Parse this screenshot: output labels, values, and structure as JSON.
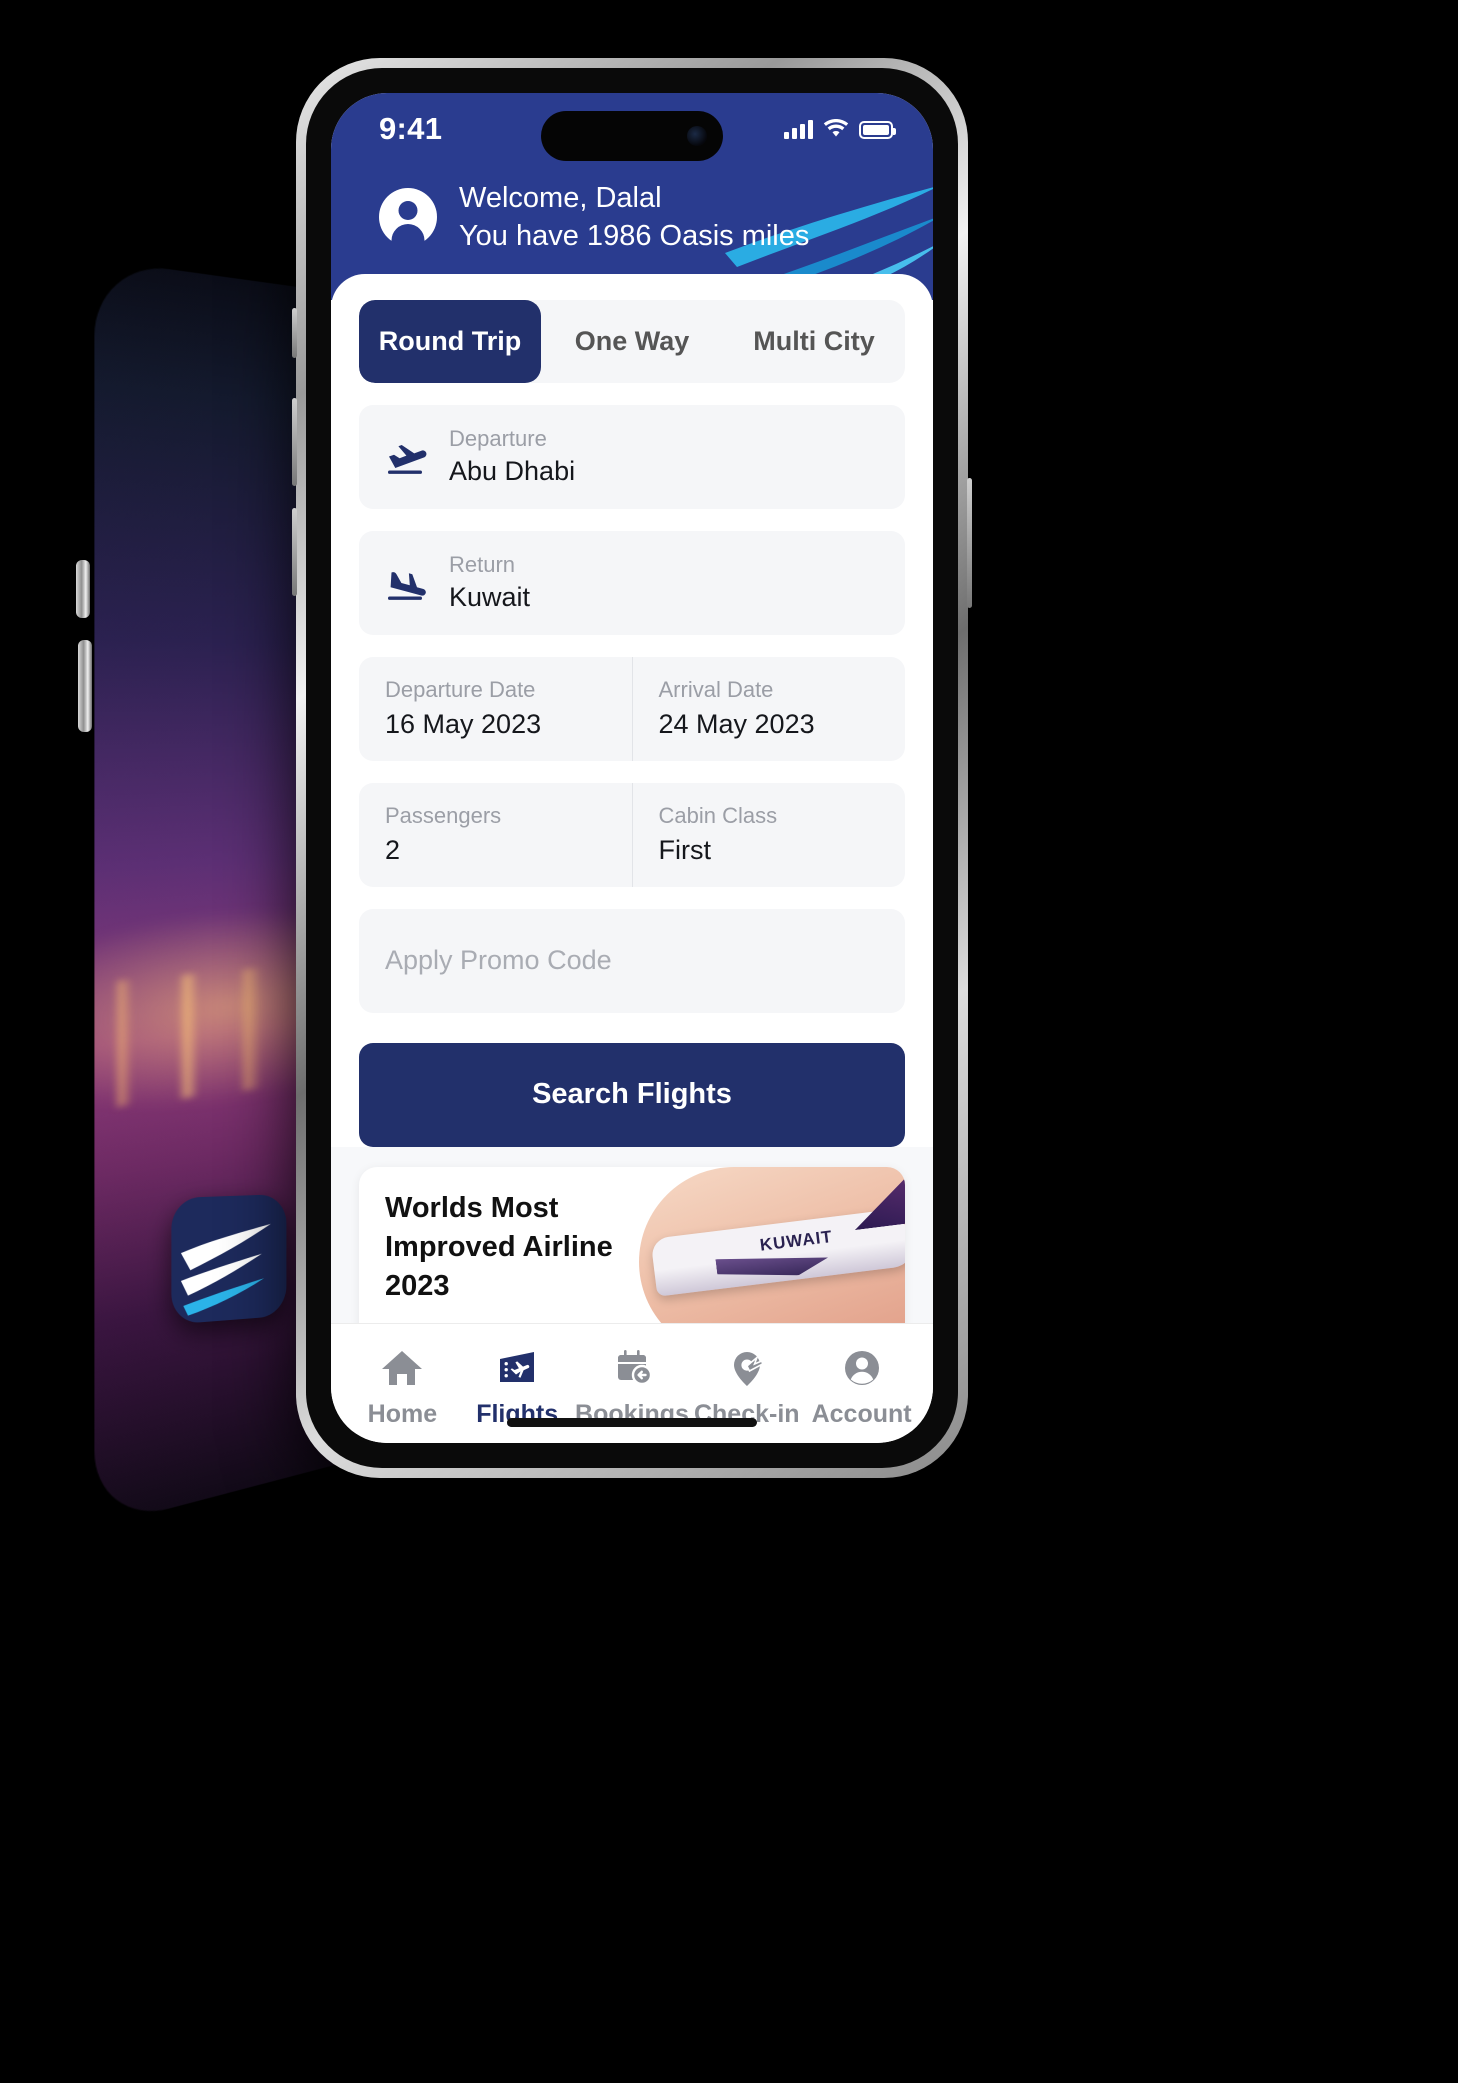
{
  "statusbar": {
    "time": "9:41",
    "signal_icon": "cellular-signal-icon",
    "wifi_icon": "wifi-icon",
    "battery_icon": "battery-full-icon"
  },
  "header": {
    "greeting": "Welcome, Dalal",
    "miles_text": "You have 1986 Oasis miles",
    "avatar_icon": "user-avatar-icon",
    "brand_icon": "kuwait-airways-swoosh-icon",
    "background_color": "#2a3c8f"
  },
  "tabs": [
    {
      "label": "Round Trip",
      "active": true
    },
    {
      "label": "One Way",
      "active": false
    },
    {
      "label": "Multi City",
      "active": false
    }
  ],
  "search_form": {
    "departure": {
      "label": "Departure",
      "value": "Abu Dhabi",
      "icon": "flight-takeoff-icon"
    },
    "return": {
      "label": "Return",
      "value": "Kuwait",
      "icon": "flight-land-icon"
    },
    "departure_date": {
      "label": "Departure Date",
      "value": "16 May 2023"
    },
    "arrival_date": {
      "label": "Arrival Date",
      "value": "24 May 2023"
    },
    "passengers": {
      "label": "Passengers",
      "value": "2"
    },
    "cabin_class": {
      "label": "Cabin Class",
      "value": "First"
    },
    "promo": {
      "placeholder": "Apply Promo Code",
      "value": ""
    },
    "submit_label": "Search Flights",
    "accent_color": "#22306b"
  },
  "promo_banner": {
    "title": "Worlds Most Improved Airline 2023",
    "image_caption": "KUWAIT"
  },
  "bottom_nav": [
    {
      "label": "Home",
      "icon": "home-icon",
      "active": false
    },
    {
      "label": "Flights",
      "icon": "flight-ticket-icon",
      "active": true
    },
    {
      "label": "Bookings",
      "icon": "calendar-clock-icon",
      "active": false
    },
    {
      "label": "Check-in",
      "icon": "check-in-location-plane-icon",
      "active": false
    },
    {
      "label": "Account",
      "icon": "account-circle-icon",
      "active": false
    }
  ]
}
